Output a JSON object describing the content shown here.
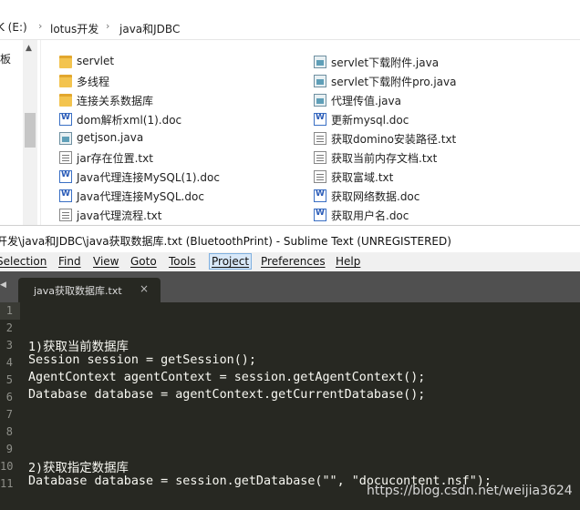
{
  "explorer": {
    "breadcrumb": [
      "K (E:)",
      "lotus开发",
      "java和JDBC"
    ],
    "nav_partial": "板",
    "left_column": [
      {
        "name": "servlet",
        "icon": "folder-icon"
      },
      {
        "name": "多线程",
        "icon": "folder-icon"
      },
      {
        "name": "连接关系数据库",
        "icon": "folder-icon"
      },
      {
        "name": "dom解析xml(1).doc",
        "icon": "doc-icon"
      },
      {
        "name": "getjson.java",
        "icon": "java-file-icon"
      },
      {
        "name": "jar存在位置.txt",
        "icon": "txt-file-icon"
      },
      {
        "name": "Java代理连接MySQL(1).doc",
        "icon": "doc-icon"
      },
      {
        "name": "Java代理连接MySQL.doc",
        "icon": "doc-icon"
      },
      {
        "name": "java代理流程.txt",
        "icon": "txt-file-icon"
      }
    ],
    "right_column": [
      {
        "name": "servlet下载附件.java",
        "icon": "java-file-icon"
      },
      {
        "name": "servlet下载附件pro.java",
        "icon": "java-file-icon"
      },
      {
        "name": "代理传值.java",
        "icon": "java-file-icon"
      },
      {
        "name": "更新mysql.doc",
        "icon": "doc-icon"
      },
      {
        "name": "获取domino安装路径.txt",
        "icon": "txt-file-icon"
      },
      {
        "name": "获取当前内存文档.txt",
        "icon": "txt-file-icon"
      },
      {
        "name": "获取富域.txt",
        "icon": "txt-file-icon"
      },
      {
        "name": "获取网络数据.doc",
        "icon": "doc-icon"
      },
      {
        "name": "获取用户名.doc",
        "icon": "doc-icon"
      }
    ]
  },
  "sublime": {
    "title": "开发\\java和JDBC\\java获取数据库.txt (BluetoothPrint) - Sublime Text (UNREGISTERED)",
    "menu": [
      "Selection",
      "Find",
      "View",
      "Goto",
      "Tools",
      "Project",
      "Preferences",
      "Help"
    ],
    "active_menu": "Project",
    "tab": {
      "name": "java获取数据库.txt",
      "close": "×"
    },
    "line_numbers": [
      "1",
      "2",
      "3",
      "4",
      "5",
      "6",
      "7",
      "8",
      "9",
      "10",
      "11"
    ],
    "code_lines": [
      "",
      "1)获取当前数据库",
      "Session session = getSession();",
      "AgentContext agentContext = session.getAgentContext();",
      "Database database = agentContext.getCurrentDatabase();",
      "",
      "",
      "",
      "2)获取指定数据库",
      "Database database = session.getDatabase(\"\", \"docucontent.nsf\");",
      ""
    ],
    "colors": {
      "editor_bg": "#272822",
      "tab_bar": "#505050",
      "code_text": "#f8f8f2",
      "gutter_text": "#8f908a"
    }
  },
  "watermark": "https://blog.csdn.net/weijia3624"
}
